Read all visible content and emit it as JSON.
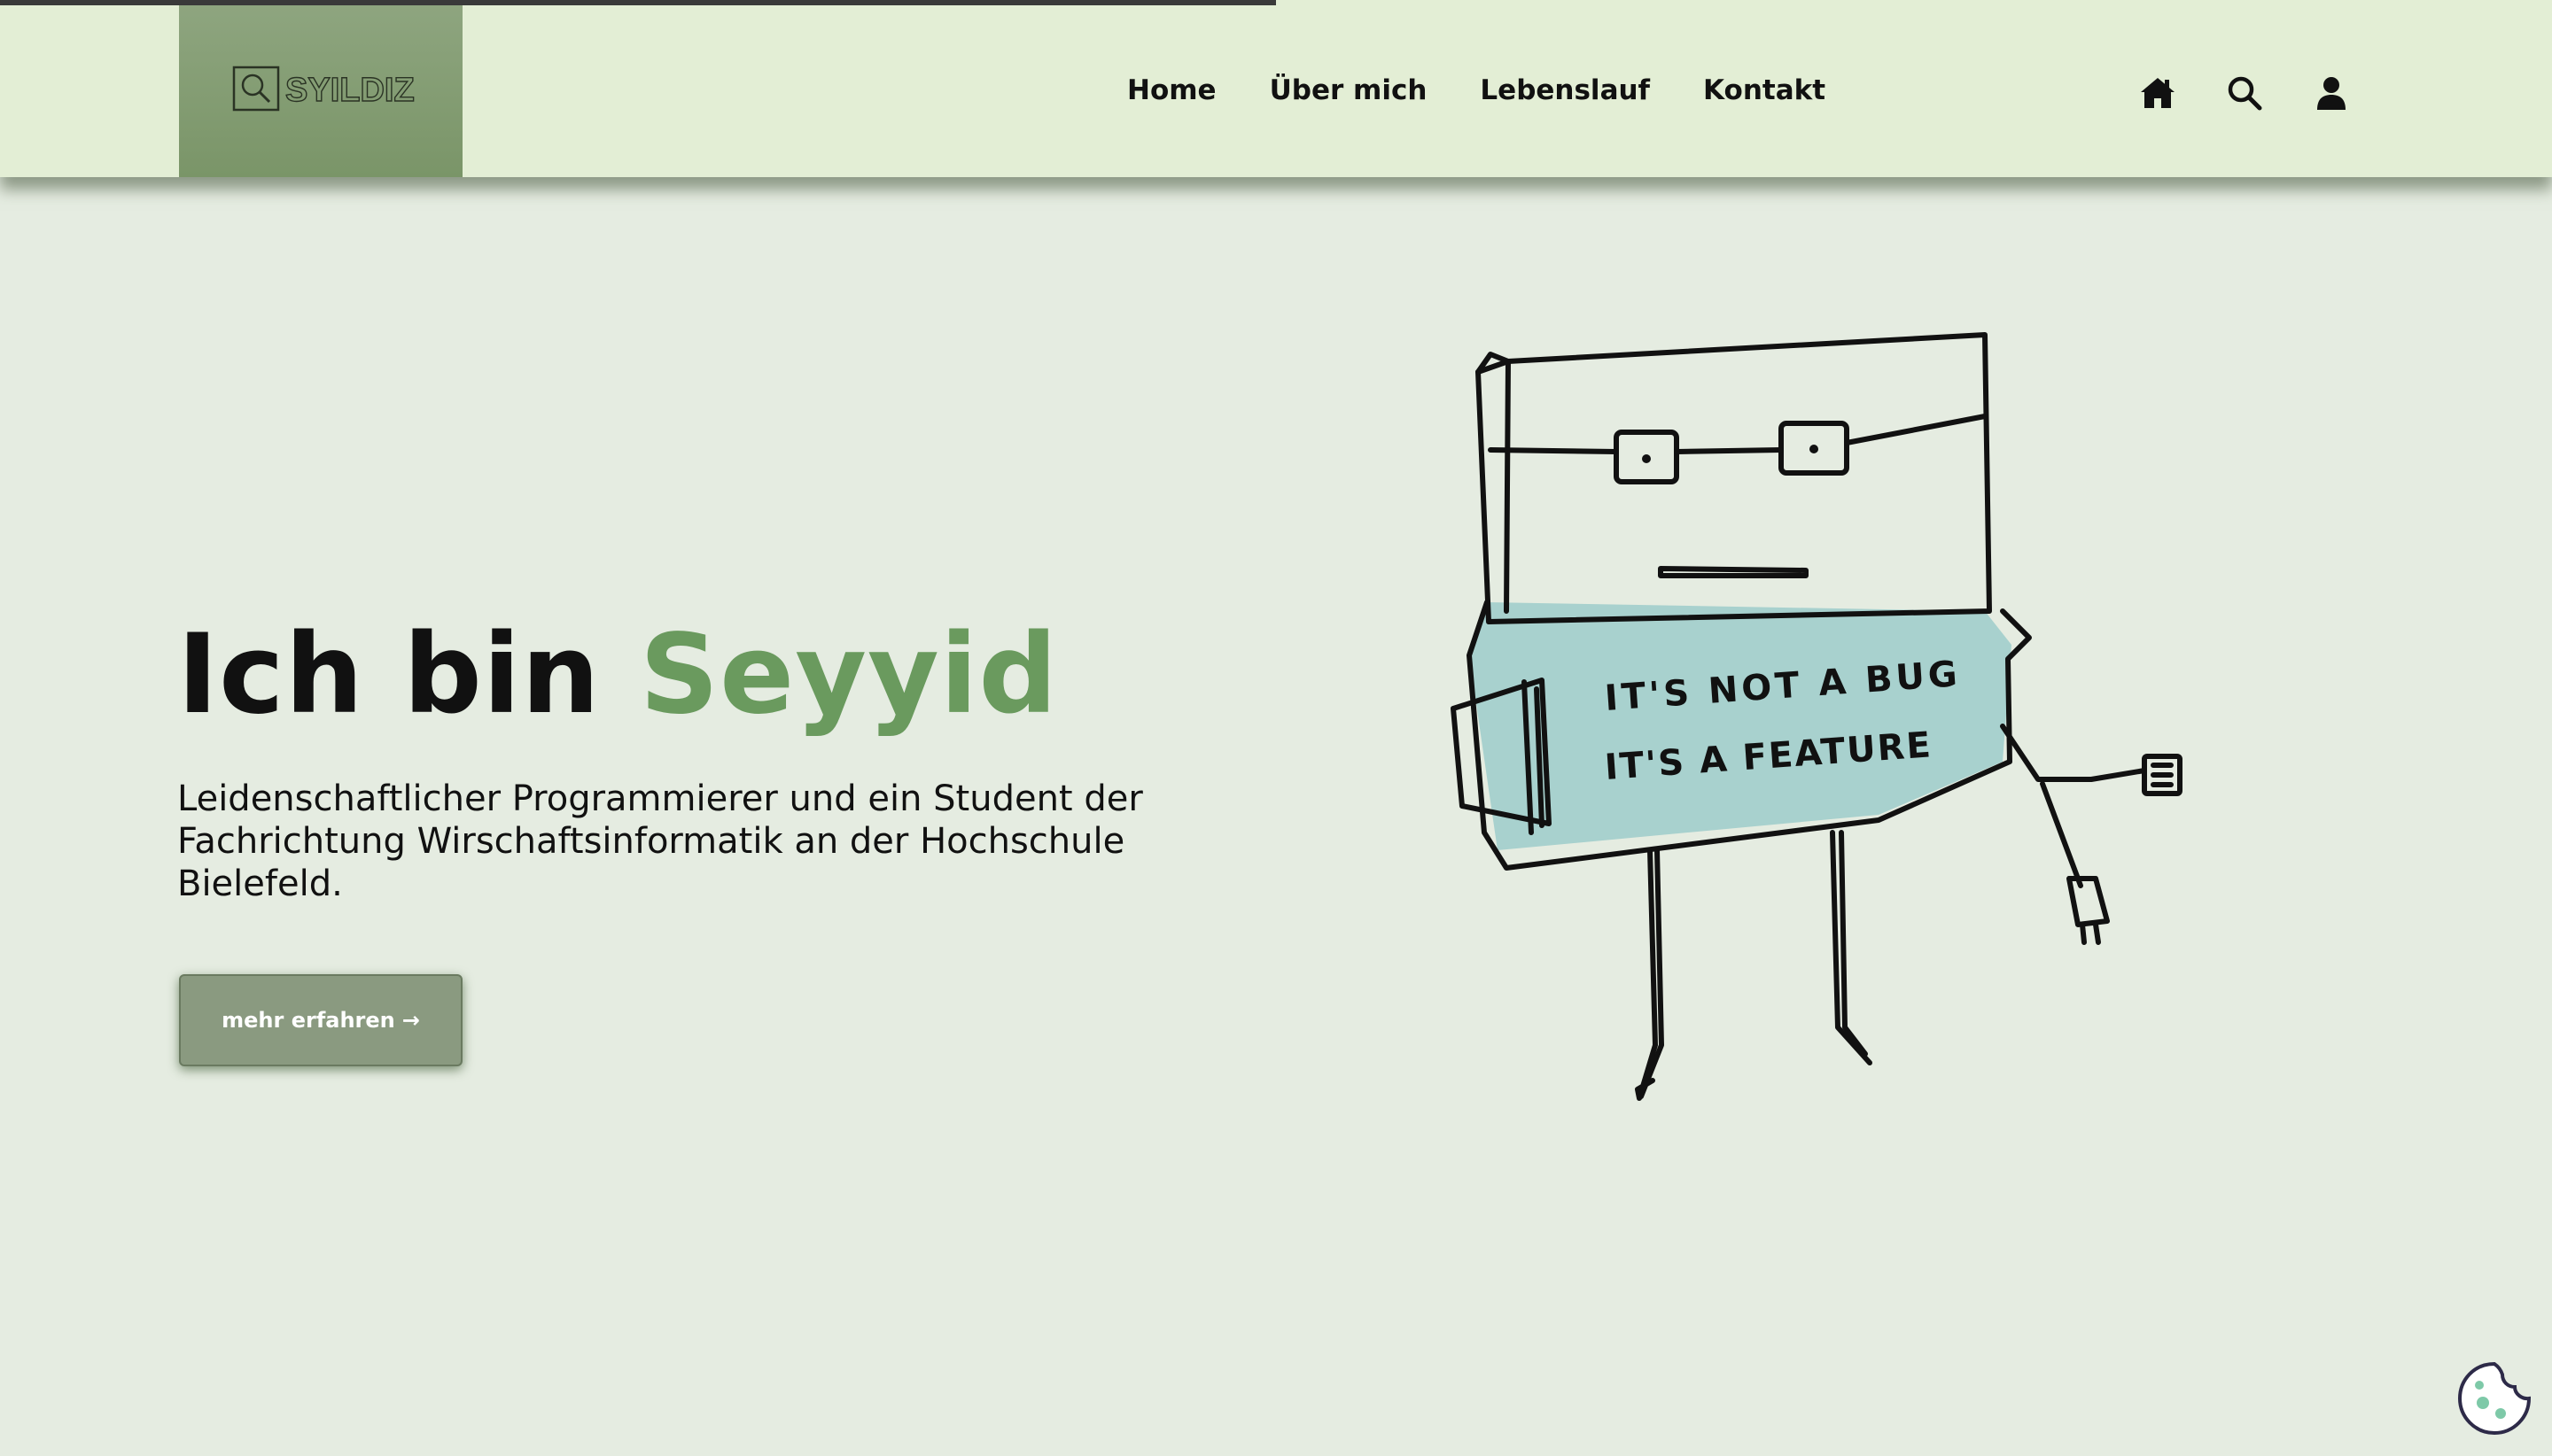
{
  "header": {
    "logo_text": "SYILDIZ",
    "nav": [
      "Home",
      "Über mich",
      "Lebenslauf",
      "Kontakt"
    ],
    "icons": [
      "home-icon",
      "search-icon",
      "user-icon"
    ]
  },
  "progress": {
    "fraction": 0.5
  },
  "hero": {
    "title_prefix": "Ich bin ",
    "title_name": "Seyyid",
    "text": "Leidenschaftlicher Programmierer und ein Student der Fachrichtung Wirschaftsinformatik an der Hochschule Bielefeld.",
    "cta_label": "mehr erfahren",
    "cta_arrow": "→"
  },
  "illustration": {
    "line1": "IT'S NOT A BUG",
    "line2": "IT'S A FEATURE"
  },
  "colors": {
    "accent": "#6a9a5e",
    "header_bg": "#e3eed5",
    "page_bg": "#e5ece1",
    "shirt": "#a8d1ce"
  }
}
